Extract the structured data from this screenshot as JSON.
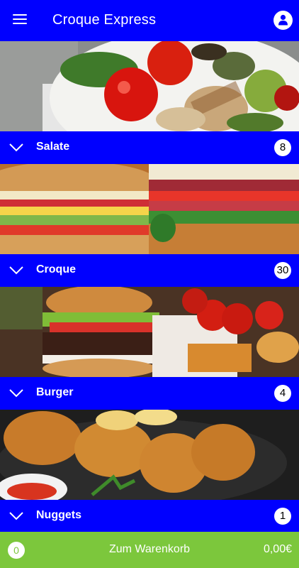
{
  "app": {
    "title": "Croque Express"
  },
  "categories": [
    {
      "label": "Salate",
      "count": "8"
    },
    {
      "label": "Croque",
      "count": "30"
    },
    {
      "label": "Burger",
      "count": "4"
    },
    {
      "label": "Nuggets",
      "count": "1"
    }
  ],
  "cart": {
    "count": "0",
    "label": "Zum Warenkorb",
    "total": "0,00€"
  },
  "colors": {
    "primary": "#0000ff",
    "cart": "#7cc73c"
  },
  "icons": {
    "menu": "hamburger-menu-icon",
    "user": "user-icon",
    "expand": "chevron-down-icon"
  }
}
